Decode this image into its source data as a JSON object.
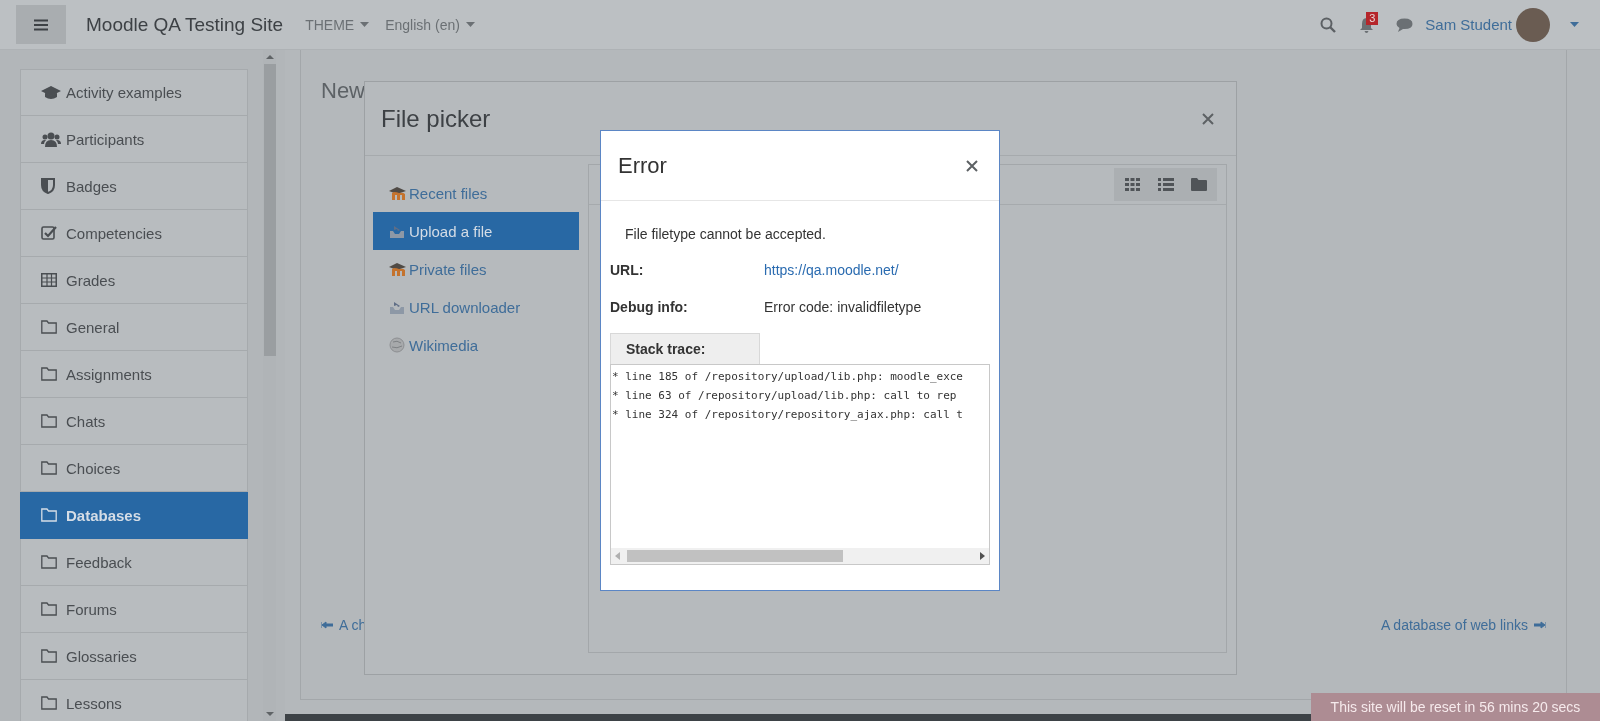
{
  "navbar": {
    "site_name": "Moodle QA Testing Site",
    "menus": [
      {
        "label": "THEME"
      },
      {
        "label": "English (en)"
      }
    ],
    "notification_count": "3",
    "user_name": "Sam Student"
  },
  "sidebar": {
    "items": [
      {
        "label": "Activity examples",
        "kind": "cap",
        "selected": false
      },
      {
        "label": "Participants",
        "kind": "users",
        "selected": false
      },
      {
        "label": "Badges",
        "kind": "shield",
        "selected": false
      },
      {
        "label": "Competencies",
        "kind": "check",
        "selected": false
      },
      {
        "label": "Grades",
        "kind": "table",
        "selected": false
      },
      {
        "label": "General",
        "kind": "folder",
        "selected": false
      },
      {
        "label": "Assignments",
        "kind": "folder",
        "selected": false
      },
      {
        "label": "Chats",
        "kind": "folder",
        "selected": false
      },
      {
        "label": "Choices",
        "kind": "folder",
        "selected": false
      },
      {
        "label": "Databases",
        "kind": "folder",
        "selected": true
      },
      {
        "label": "Feedback",
        "kind": "folder",
        "selected": false
      },
      {
        "label": "Forums",
        "kind": "folder",
        "selected": false
      },
      {
        "label": "Glossaries",
        "kind": "folder",
        "selected": false
      },
      {
        "label": "Lessons",
        "kind": "folder",
        "selected": false
      }
    ]
  },
  "main": {
    "heading": "New",
    "prev_link": "A ch",
    "next_link": "A database of web links"
  },
  "file_picker": {
    "title": "File picker",
    "repositories": [
      {
        "label": "Recent files",
        "kind": "cap",
        "selected": false
      },
      {
        "label": "Upload a file",
        "kind": "tray",
        "selected": true
      },
      {
        "label": "Private files",
        "kind": "cap",
        "selected": false
      },
      {
        "label": "URL downloader",
        "kind": "tray",
        "selected": false
      },
      {
        "label": "Wikimedia",
        "kind": "globe",
        "selected": false
      }
    ]
  },
  "error_dialog": {
    "title": "Error",
    "message": "File filetype cannot be accepted.",
    "fields": [
      {
        "label": "URL:",
        "value": "https://qa.moodle.net/",
        "kind": "link"
      },
      {
        "label": "Debug info:",
        "value": "Error code: invalidfiletype",
        "kind": "text"
      }
    ],
    "stack_trace": {
      "label": "Stack trace:",
      "lines": [
        "* line 185 of /repository/upload/lib.php: moodle_exce",
        "* line 63 of /repository/upload/lib.php: call to rep",
        "* line 324 of /repository/repository_ajax.php: call t"
      ]
    }
  },
  "reset_banner": "This site will be reset in 56 mins 20 secs"
}
